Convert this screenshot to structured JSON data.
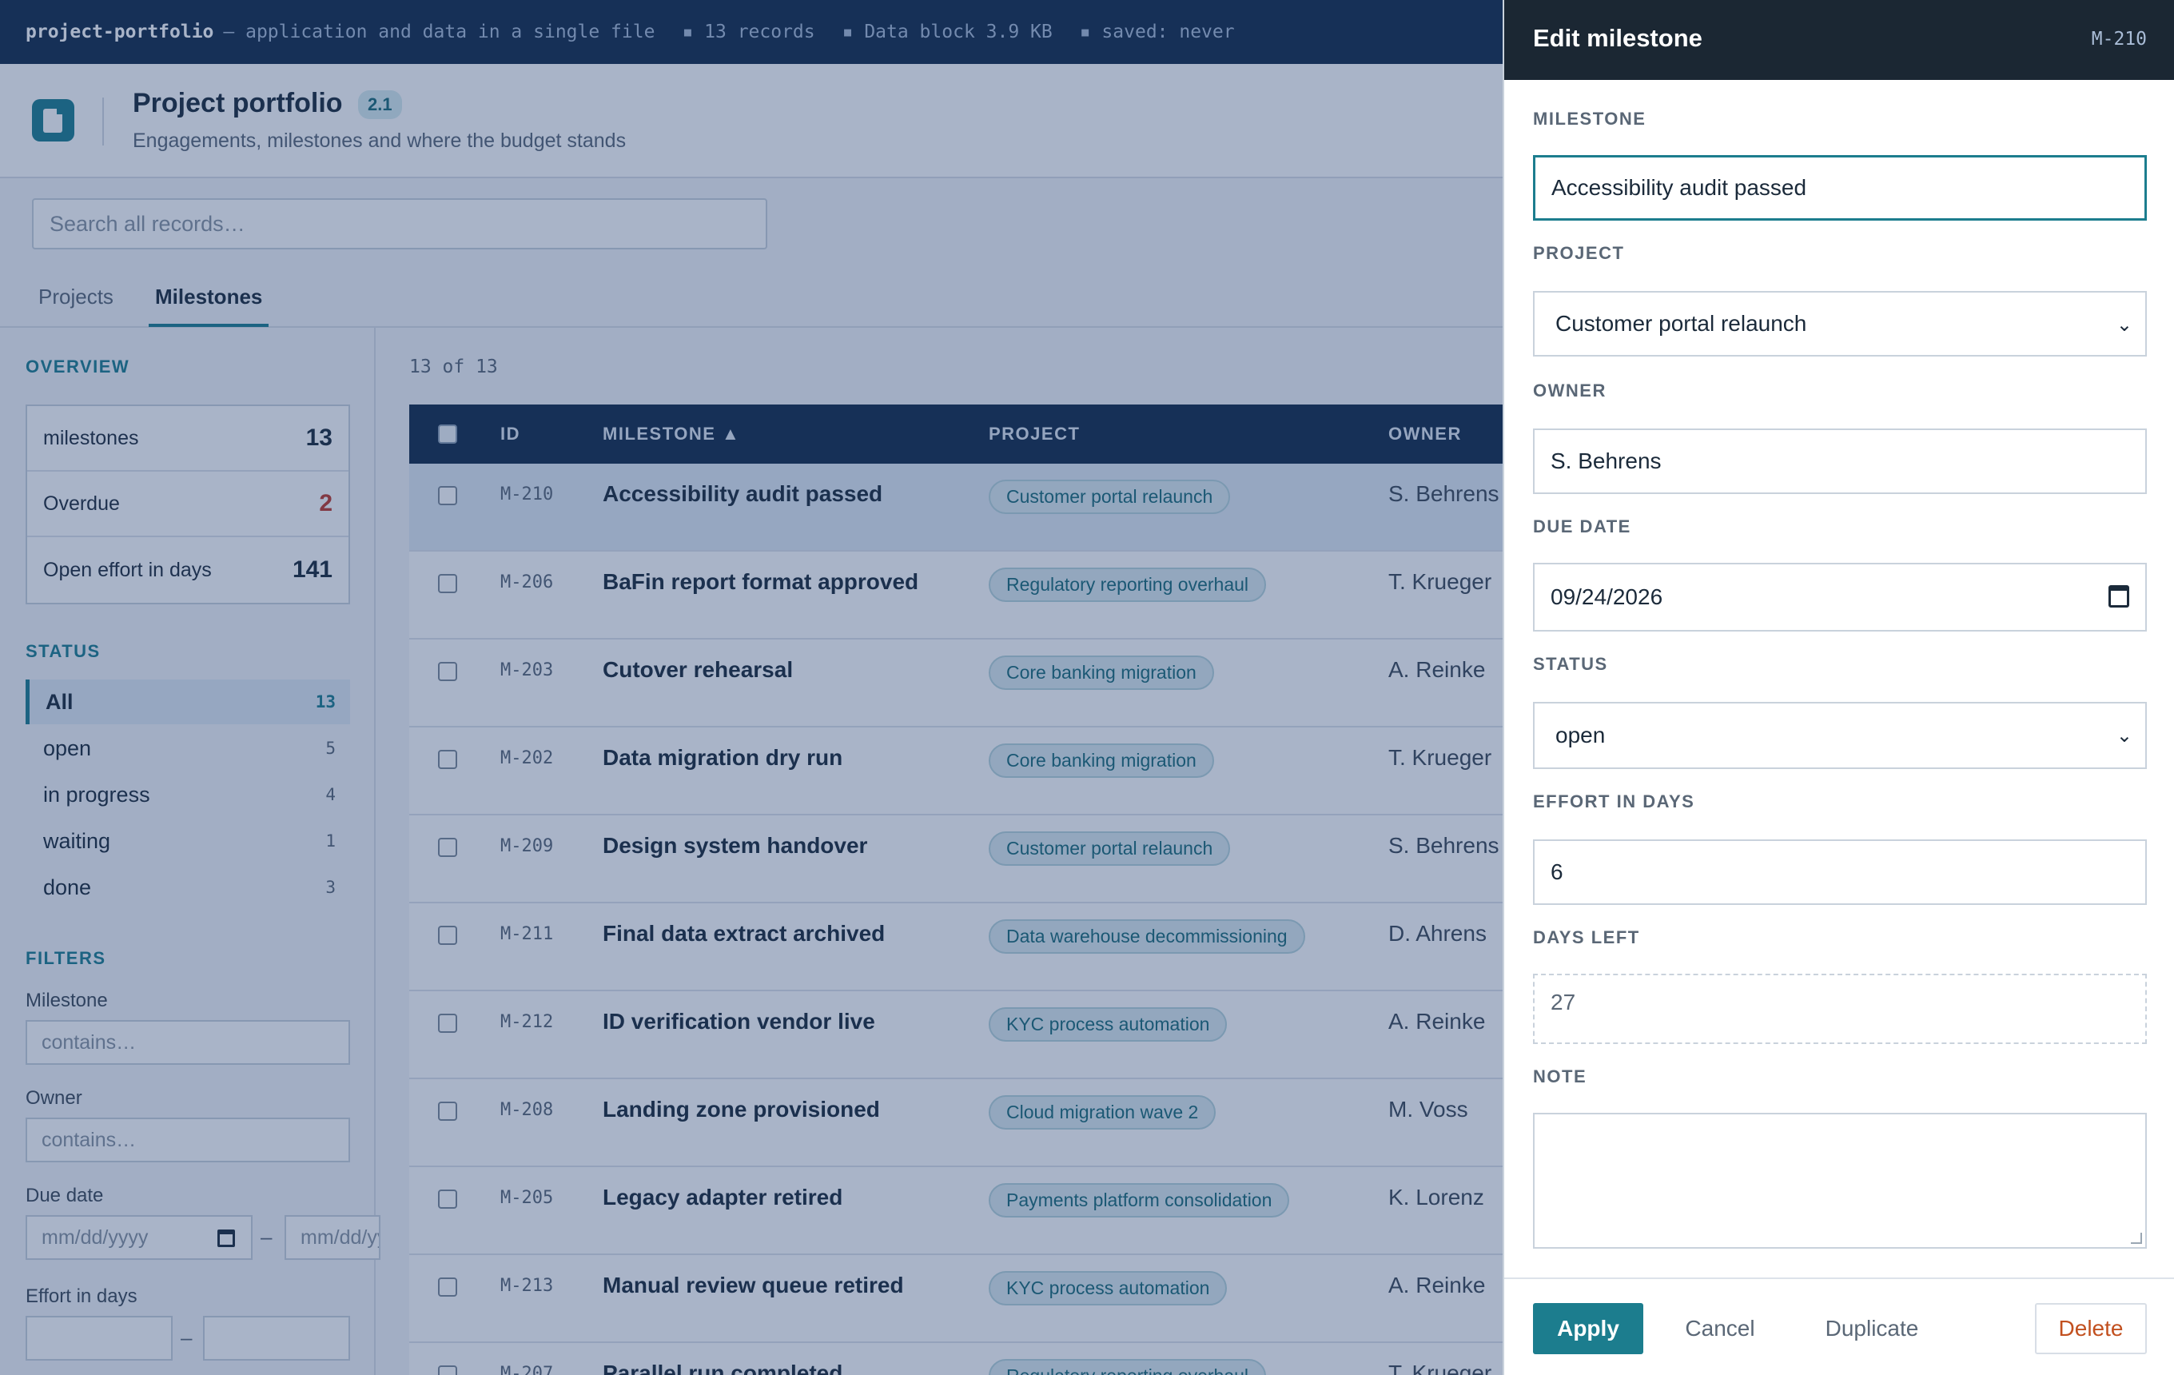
{
  "topbar": {
    "app_name": "project-portfolio",
    "tagline": "— application and data in a single file",
    "records": "▪ 13 records",
    "data_block": "▪ Data block 3.9 KB",
    "saved": "▪ saved: never"
  },
  "header": {
    "title": "Project portfolio",
    "version": "2.1",
    "subtitle": "Engagements, milestones and where the budget stands",
    "logo_icon": "document-icon"
  },
  "search": {
    "placeholder": "Search all records…"
  },
  "tabs": [
    {
      "label": "Projects",
      "active": false
    },
    {
      "label": "Milestones",
      "active": true
    }
  ],
  "sidebar": {
    "overview_title": "OVERVIEW",
    "stats": [
      {
        "label": "milestones",
        "value": "13"
      },
      {
        "label": "Overdue",
        "value": "2"
      },
      {
        "label": "Open effort in days",
        "value": "141"
      }
    ],
    "status_title": "STATUS",
    "statuses": [
      {
        "label": "All",
        "count": "13",
        "active": true
      },
      {
        "label": "open",
        "count": "5"
      },
      {
        "label": "in progress",
        "count": "4"
      },
      {
        "label": "waiting",
        "count": "1"
      },
      {
        "label": "done",
        "count": "3"
      }
    ],
    "filters_title": "FILTERS",
    "filters": {
      "milestone_label": "Milestone",
      "milestone_placeholder": "contains…",
      "owner_label": "Owner",
      "owner_placeholder": "contains…",
      "due_label": "Due date",
      "due_from_placeholder": "mm/dd/yyyy",
      "due_to_placeholder": "mm/dd/yyyy",
      "range_dash": "–",
      "effort_label": "Effort in days"
    }
  },
  "table": {
    "count": "13 of 13",
    "columns": {
      "id": "ID",
      "milestone": "MILESTONE ▲",
      "project": "PROJECT",
      "owner": "OWNER"
    },
    "rows": [
      {
        "id": "M-210",
        "milestone": "Accessibility audit passed",
        "project": "Customer portal relaunch",
        "owner": "S. Behrens",
        "selected": true
      },
      {
        "id": "M-206",
        "milestone": "BaFin report format approved",
        "project": "Regulatory reporting overhaul",
        "owner": "T. Krueger"
      },
      {
        "id": "M-203",
        "milestone": "Cutover rehearsal",
        "project": "Core banking migration",
        "owner": "A. Reinke"
      },
      {
        "id": "M-202",
        "milestone": "Data migration dry run",
        "project": "Core banking migration",
        "owner": "T. Krueger"
      },
      {
        "id": "M-209",
        "milestone": "Design system handover",
        "project": "Customer portal relaunch",
        "owner": "S. Behrens"
      },
      {
        "id": "M-211",
        "milestone": "Final data extract archived",
        "project": "Data warehouse decommissioning",
        "owner": "D. Ahrens"
      },
      {
        "id": "M-212",
        "milestone": "ID verification vendor live",
        "project": "KYC process automation",
        "owner": "A. Reinke"
      },
      {
        "id": "M-208",
        "milestone": "Landing zone provisioned",
        "project": "Cloud migration wave 2",
        "owner": "M. Voss"
      },
      {
        "id": "M-205",
        "milestone": "Legacy adapter retired",
        "project": "Payments platform consolidation",
        "owner": "K. Lorenz"
      },
      {
        "id": "M-213",
        "milestone": "Manual review queue retired",
        "project": "KYC process automation",
        "owner": "A. Reinke"
      },
      {
        "id": "M-207",
        "milestone": "Parallel run completed",
        "project": "Regulatory reporting overhaul",
        "owner": "T. Krueger"
      }
    ]
  },
  "drawer": {
    "title": "Edit milestone",
    "record_id": "M-210",
    "fields": {
      "milestone_label": "MILESTONE",
      "milestone_value": "Accessibility audit passed",
      "project_label": "PROJECT",
      "project_value": "Customer portal relaunch",
      "owner_label": "OWNER",
      "owner_value": "S. Behrens",
      "due_label": "DUE DATE",
      "due_value": "09/24/2026",
      "status_label": "STATUS",
      "status_value": "open",
      "effort_label": "EFFORT IN DAYS",
      "effort_value": "6",
      "days_left_label": "DAYS LEFT",
      "days_left_value": "27",
      "note_label": "NOTE",
      "note_value": ""
    },
    "buttons": {
      "apply": "Apply",
      "cancel": "Cancel",
      "duplicate": "Duplicate",
      "delete": "Delete"
    }
  },
  "colors": {
    "accent": "#1c7d8e",
    "topbar": "#132b4a",
    "danger": "#c0392b"
  }
}
